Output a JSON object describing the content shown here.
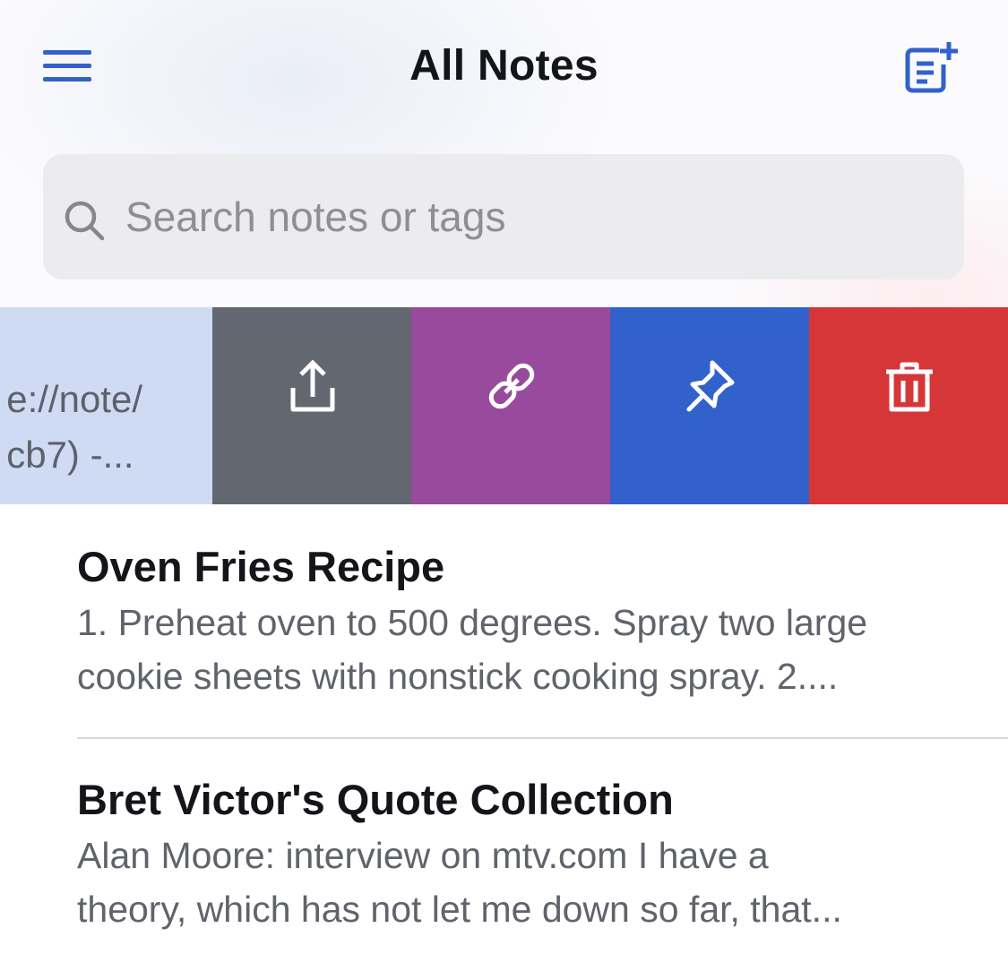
{
  "header": {
    "title": "All Notes",
    "menu_icon": "hamburger-menu-icon",
    "new_note_icon": "new-note-icon"
  },
  "search": {
    "placeholder": "Search notes or tags",
    "value": "",
    "icon": "search-icon"
  },
  "swiped_note": {
    "preview_lines": [
      "e://note/",
      "cb7) -..."
    ]
  },
  "swipe_actions": [
    {
      "id": "share",
      "icon": "share-icon",
      "color": "#636770"
    },
    {
      "id": "copy-link",
      "icon": "link-icon",
      "color": "#984b9c"
    },
    {
      "id": "pin",
      "icon": "pin-icon",
      "color": "#3361cc"
    },
    {
      "id": "trash",
      "icon": "trash-icon",
      "color": "#d63638"
    }
  ],
  "notes": [
    {
      "title": "Oven Fries Recipe",
      "preview_lines": [
        "1. Preheat oven to 500 degrees. Spray two large",
        "cookie sheets with nonstick cooking spray. 2...."
      ]
    },
    {
      "title": "Bret Victor's Quote Collection",
      "preview_lines": [
        "Alan Moore: interview on mtv.com  I have a",
        "theory, which has not let me down so far, that..."
      ]
    }
  ],
  "colors": {
    "accent": "#3361cc",
    "title_text": "#14151a",
    "preview_text": "#60636b",
    "search_bg": "#ececef",
    "swiped_row_bg": "#cfdbf2"
  }
}
